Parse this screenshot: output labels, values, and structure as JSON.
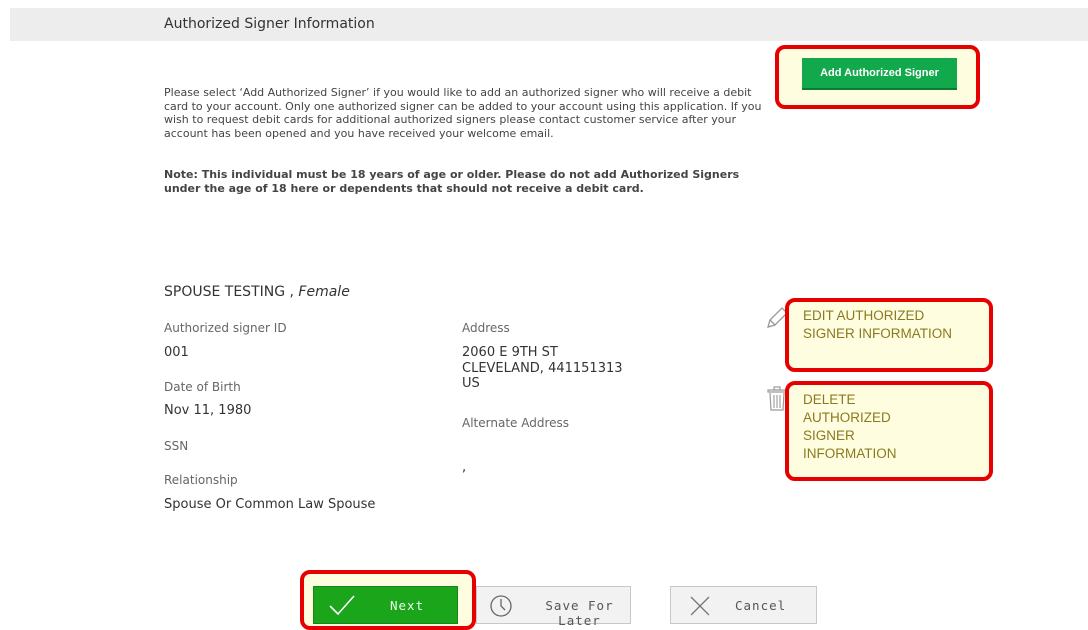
{
  "section": {
    "title": "Authorized Signer Information"
  },
  "add_button": {
    "label": "Add Authorized Signer"
  },
  "intro": {
    "text": "Please select ‘Add Authorized Signer’ if you would like to add an authorized signer who will receive a debit card to your account.   Only one authorized signer can be added to your account using this application.  If you wish to request debit cards for additional authorized signers please contact customer service after your account has been opened and you have received your welcome email.",
    "note": "Note: This individual must be 18 years of age or older. Please do not add Authorized Signers under the age of 18 here or dependents that should not receive a debit card."
  },
  "signer": {
    "name": "SPOUSE TESTING ,",
    "gender": "Female",
    "id_label": "Authorized signer ID",
    "id_value": "001",
    "dob_label": "Date of Birth",
    "dob_value": "Nov 11, 1980",
    "ssn_label": "SSN",
    "relationship_label": "Relationship",
    "relationship_value": "Spouse Or Common Law Spouse",
    "address_label": "Address",
    "address_line1": "2060 E 9TH ST",
    "address_line2": "CLEVELAND, 441151313",
    "address_line3": "US",
    "alt_address_label": "Alternate Address",
    "alt_address_value": ","
  },
  "actions": {
    "edit_label": "EDIT AUTHORIZED SIGNER INFORMATION",
    "delete_label": "DELETE AUTHORIZED SIGNER INFORMATION"
  },
  "footer": {
    "next_label": "Next",
    "save_label": "Save For Later",
    "cancel_label": "Cancel"
  },
  "colors": {
    "add_button_green": "#12a84c",
    "next_button_green": "#1aa51a",
    "highlight_red": "#e60000",
    "highlight_fill": "#fffde0",
    "action_text": "#8a7a1f"
  },
  "icons": [
    "pencil-icon",
    "trash-icon",
    "checkmark-icon",
    "clock-icon",
    "close-icon"
  ]
}
